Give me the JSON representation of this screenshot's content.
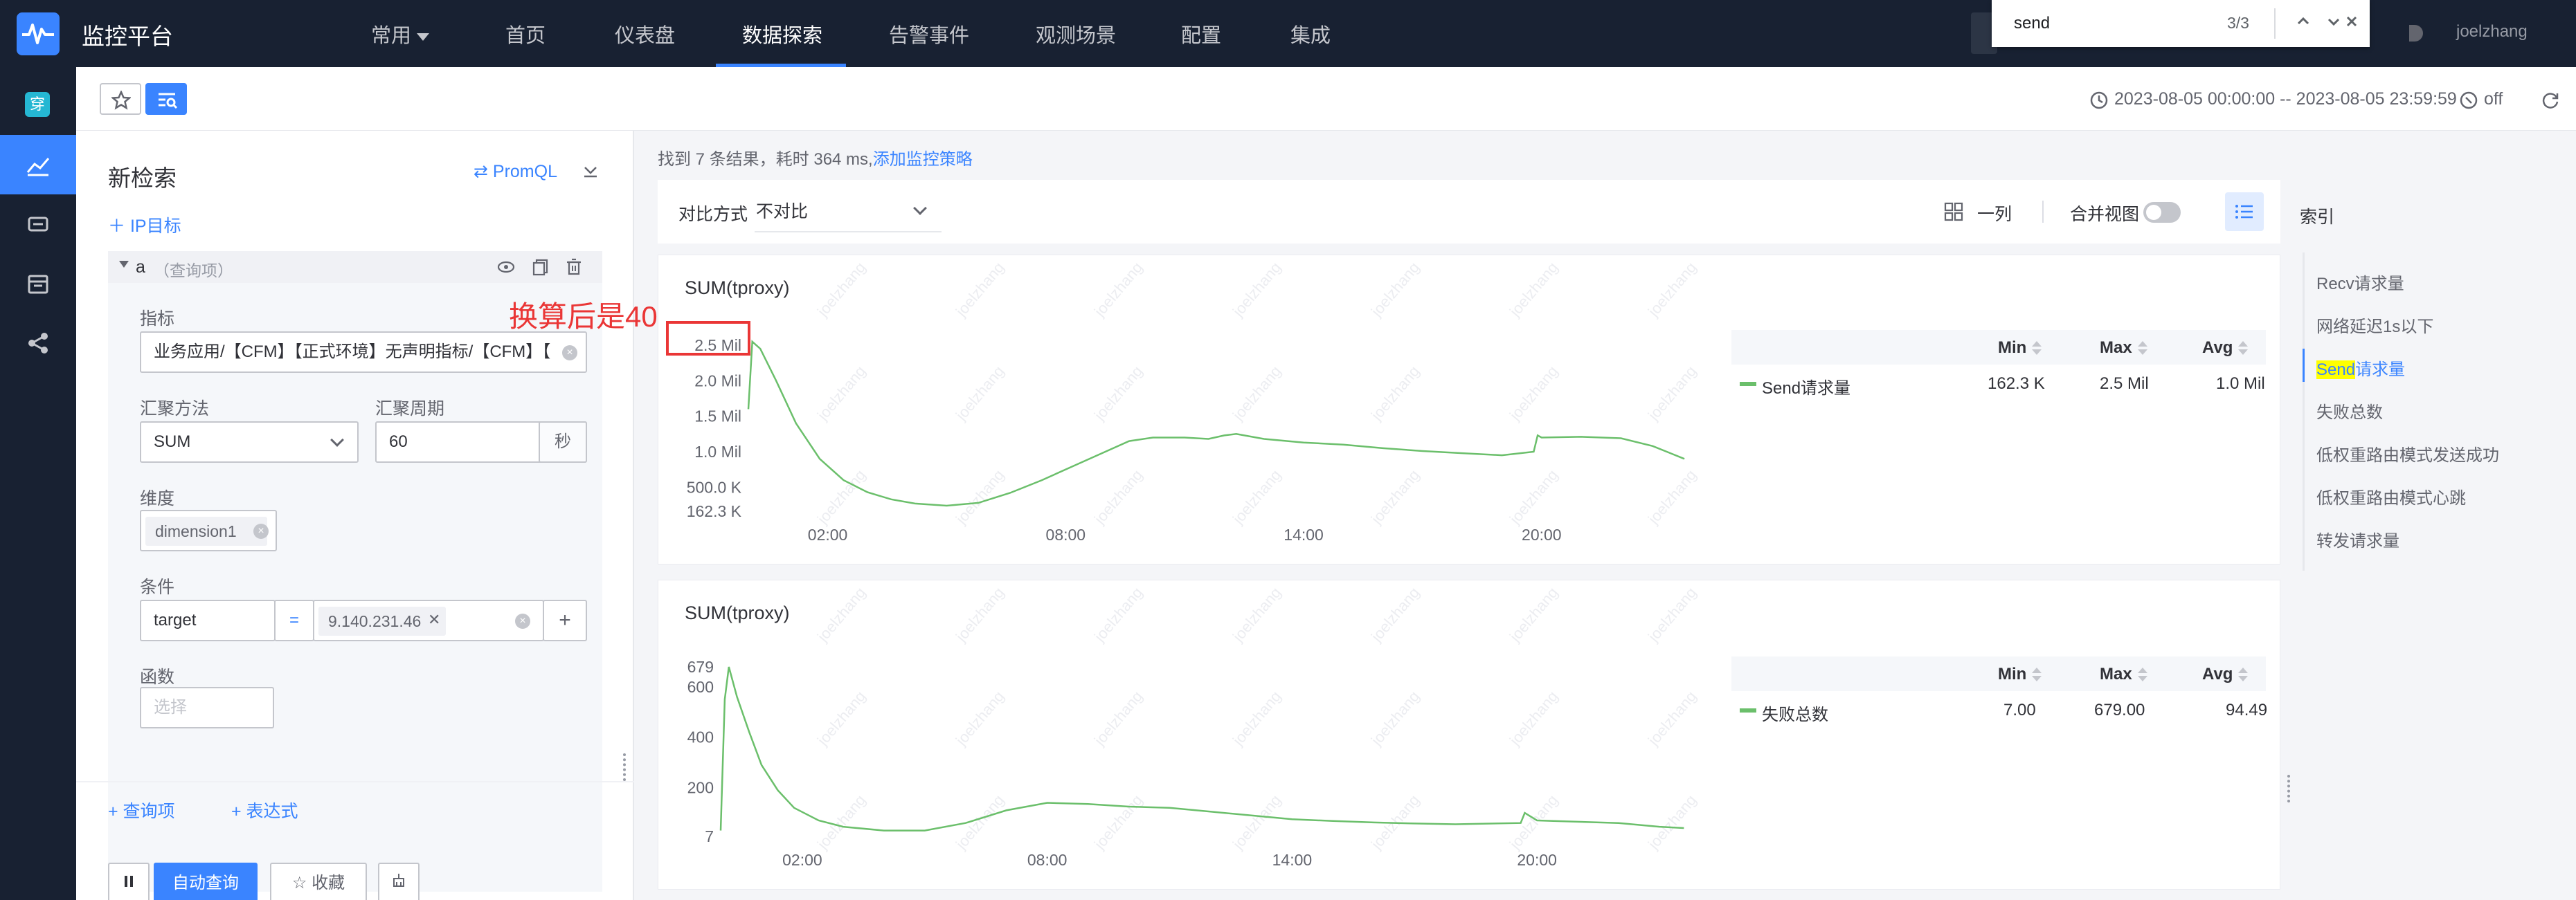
{
  "app": {
    "title": "监控平台"
  },
  "nav": {
    "items": [
      {
        "label": "常用",
        "has_caret": true
      },
      {
        "label": "首页"
      },
      {
        "label": "仪表盘"
      },
      {
        "label": "数据探索",
        "active": true
      },
      {
        "label": "告警事件"
      },
      {
        "label": "观测场景"
      },
      {
        "label": "配置"
      },
      {
        "label": "集成"
      }
    ],
    "username": "joelzhang"
  },
  "find_bar": {
    "query": "send",
    "count": "3/3"
  },
  "left_nav": {
    "app_badge": "穿"
  },
  "subheader": {
    "time_range": "2023-08-05 00:00:00 -- 2023-08-05 23:59:59",
    "refresh": "off"
  },
  "query_panel": {
    "title": "新检索",
    "promql_label": "PromQL",
    "ip_target": "IP目标",
    "item": {
      "name": "a",
      "subtitle": "（查询项）"
    },
    "metric_label": "指标",
    "metric_value": "业务应用/【CFM】【正式环境】无声明指标/【CFM】【",
    "agg_method_label": "汇聚方法",
    "agg_method_value": "SUM",
    "agg_period_label": "汇聚周期",
    "agg_period_value": "60",
    "agg_period_unit": "秒",
    "dimension_label": "维度",
    "dimension_tag": "dimension1",
    "condition_label": "条件",
    "condition_key": "target",
    "condition_op": "=",
    "condition_value": "9.140.231.46",
    "function_label": "函数",
    "function_placeholder": "选择",
    "add_query": "+ 查询项",
    "add_expression": "+ 表达式",
    "auto_query": "自动查询",
    "favorite": "收藏",
    "annotation": "换算后是40kp/s"
  },
  "results": {
    "summary_prefix": "找到 7 条结果，耗时 364 ms,",
    "summary_link": "添加监控策略",
    "compare_label": "对比方式",
    "compare_value": "不对比",
    "layout_label": "一列",
    "merge_label": "合并视图",
    "watermark": "joelzhang"
  },
  "index_panel": {
    "title": "索引",
    "items": [
      {
        "label": "Recv请求量"
      },
      {
        "label": "网络延迟1s以下"
      },
      {
        "label": "请求量",
        "hl": "Send",
        "active": true
      },
      {
        "label": "失败总数"
      },
      {
        "label": "低权重路由模式发送成功"
      },
      {
        "label": "低权重路由模式心跳"
      },
      {
        "label": "转发请求量"
      }
    ]
  },
  "legend_headers": {
    "min": "Min",
    "max": "Max",
    "avg": "Avg"
  },
  "chart_data": [
    {
      "type": "line",
      "title": "SUM(tproxy)",
      "x_ticks": [
        "02:00",
        "08:00",
        "14:00",
        "20:00"
      ],
      "x_range_hours": [
        0,
        24
      ],
      "y_ticks": [
        "2.5 Mil",
        "2.0 Mil",
        "1.5 Mil",
        "1.0 Mil",
        "500.0 K",
        "162.3 K"
      ],
      "y_range": [
        162300,
        2500000
      ],
      "color": "#6bbf6b",
      "series": [
        {
          "name": "Send请求量",
          "min": "162.3 K",
          "max": "2.5 Mil",
          "avg": "1.0 Mil",
          "points": [
            [
              0.0,
              1600000
            ],
            [
              0.1,
              2550000
            ],
            [
              0.3,
              2450000
            ],
            [
              0.7,
              2000000
            ],
            [
              1.2,
              1400000
            ],
            [
              1.8,
              900000
            ],
            [
              2.4,
              600000
            ],
            [
              3.0,
              430000
            ],
            [
              3.6,
              330000
            ],
            [
              4.2,
              270000
            ],
            [
              5.0,
              240000
            ],
            [
              5.8,
              280000
            ],
            [
              6.6,
              420000
            ],
            [
              7.4,
              600000
            ],
            [
              8.2,
              800000
            ],
            [
              9.0,
              1000000
            ],
            [
              9.6,
              1150000
            ],
            [
              10.2,
              1200000
            ],
            [
              11.0,
              1200000
            ],
            [
              11.6,
              1180000
            ],
            [
              12.0,
              1230000
            ],
            [
              12.3,
              1250000
            ],
            [
              13.0,
              1180000
            ],
            [
              14.0,
              1130000
            ],
            [
              15.0,
              1100000
            ],
            [
              16.0,
              1050000
            ],
            [
              17.0,
              1010000
            ],
            [
              18.0,
              980000
            ],
            [
              19.0,
              950000
            ],
            [
              19.8,
              1000000
            ],
            [
              19.9,
              1230000
            ],
            [
              20.0,
              1200000
            ],
            [
              21.0,
              1210000
            ],
            [
              22.0,
              1190000
            ],
            [
              22.8,
              1080000
            ],
            [
              23.6,
              900000
            ]
          ]
        }
      ]
    },
    {
      "type": "line",
      "title": "SUM(tproxy)",
      "x_ticks": [
        "02:00",
        "08:00",
        "14:00",
        "20:00"
      ],
      "x_range_hours": [
        0,
        24
      ],
      "y_ticks": [
        "679",
        "600",
        "400",
        "200",
        "7"
      ],
      "y_range": [
        7,
        679
      ],
      "color": "#6bbf6b",
      "series": [
        {
          "name": "失败总数",
          "min": "7.00",
          "max": "679.00",
          "avg": "94.49",
          "points": [
            [
              0.0,
              30
            ],
            [
              0.1,
              550
            ],
            [
              0.2,
              679
            ],
            [
              0.4,
              560
            ],
            [
              0.7,
              420
            ],
            [
              1.0,
              290
            ],
            [
              1.4,
              190
            ],
            [
              1.8,
              120
            ],
            [
              2.4,
              70
            ],
            [
              3.0,
              45
            ],
            [
              4.0,
              30
            ],
            [
              5.0,
              30
            ],
            [
              6.0,
              60
            ],
            [
              7.0,
              110
            ],
            [
              8.0,
              140
            ],
            [
              9.0,
              135
            ],
            [
              10.0,
              125
            ],
            [
              11.0,
              120
            ],
            [
              12.0,
              105
            ],
            [
              13.0,
              90
            ],
            [
              14.0,
              75
            ],
            [
              15.0,
              68
            ],
            [
              16.0,
              62
            ],
            [
              17.0,
              58
            ],
            [
              18.0,
              55
            ],
            [
              19.6,
              60
            ],
            [
              19.7,
              100
            ],
            [
              20.0,
              70
            ],
            [
              21.0,
              65
            ],
            [
              22.0,
              60
            ],
            [
              23.0,
              45
            ],
            [
              23.6,
              40
            ]
          ]
        }
      ]
    }
  ]
}
